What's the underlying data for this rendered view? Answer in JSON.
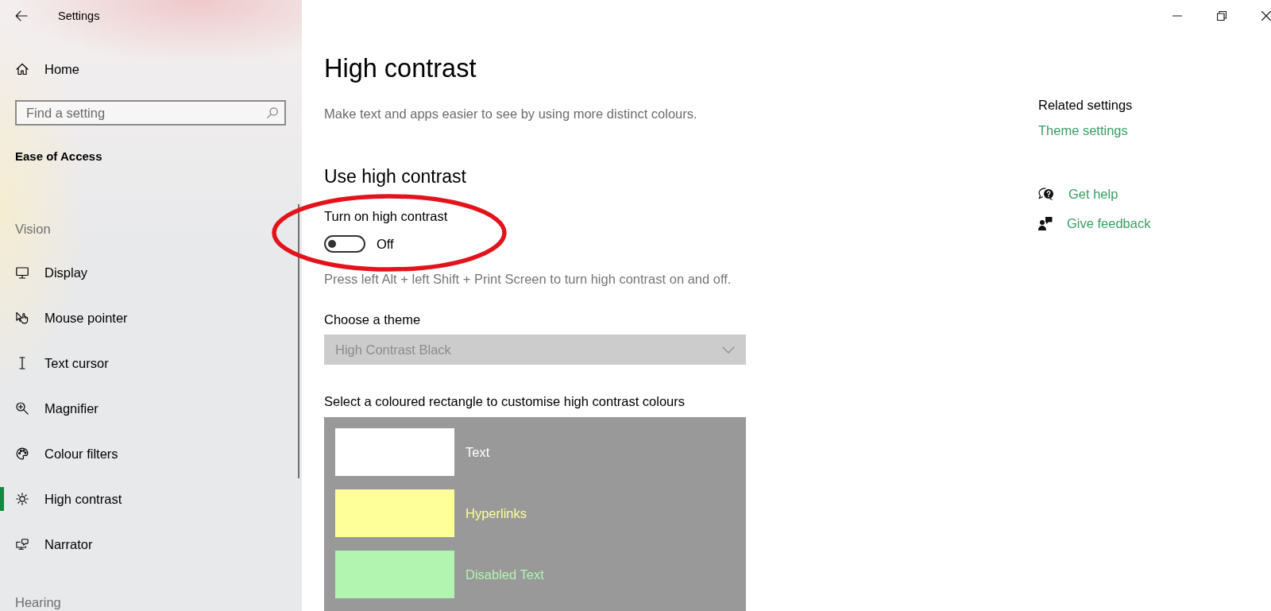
{
  "window": {
    "title": "Settings"
  },
  "sidebar": {
    "home": "Home",
    "search": {
      "placeholder": "Find a setting"
    },
    "section_title": "Ease of Access",
    "groups": [
      {
        "heading": "Vision",
        "items": [
          {
            "label": "Display",
            "selected": false
          },
          {
            "label": "Mouse pointer",
            "selected": false
          },
          {
            "label": "Text cursor",
            "selected": false
          },
          {
            "label": "Magnifier",
            "selected": false
          },
          {
            "label": "Colour filters",
            "selected": false
          },
          {
            "label": "High contrast",
            "selected": true
          },
          {
            "label": "Narrator",
            "selected": false
          }
        ]
      },
      {
        "heading": "Hearing"
      }
    ]
  },
  "page": {
    "title": "High contrast",
    "description": "Make text and apps easier to see by using more distinct colours.",
    "section_title": "Use high contrast",
    "toggle": {
      "label": "Turn on high contrast",
      "on": false,
      "state_text": "Off",
      "circled": true
    },
    "hint": "Press left Alt + left Shift + Print Screen to turn high contrast on and off.",
    "theme": {
      "label": "Choose a theme",
      "value": "High Contrast Black",
      "disabled": true
    },
    "colours": {
      "label": "Select a coloured rectangle to customise high contrast colours",
      "items": [
        {
          "label": "Text",
          "color": "#ffffff"
        },
        {
          "label": "Hyperlinks",
          "color": "#ffff99"
        },
        {
          "label": "Disabled Text",
          "color": "#b2f5b0"
        }
      ]
    }
  },
  "related": {
    "heading": "Related settings",
    "links": [
      "Theme settings"
    ]
  },
  "support_links": [
    "Get help",
    "Give feedback"
  ]
}
